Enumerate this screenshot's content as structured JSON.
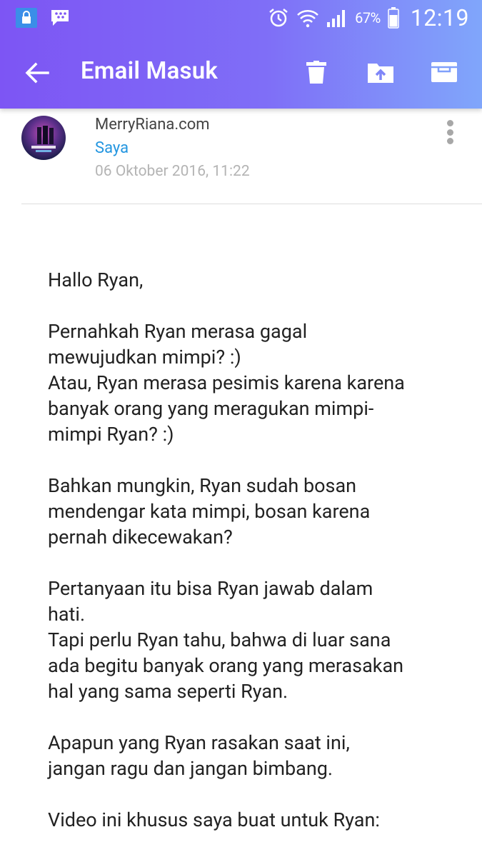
{
  "status_bar": {
    "battery_percent": "67%",
    "time": "12:19",
    "icons": [
      "lock-icon",
      "bbm-icon",
      "alarm-icon",
      "wifi-icon",
      "signal-icon",
      "battery-icon"
    ]
  },
  "app_bar": {
    "title": "Email Masuk",
    "back_icon": "arrow-back-icon",
    "actions": [
      "delete-icon",
      "move-to-folder-icon",
      "archive-icon"
    ],
    "gradient_colors": [
      "#7d55f4",
      "#80a6fb"
    ]
  },
  "message": {
    "sender": "MerryRiana.com",
    "recipient": "Saya",
    "date": "06 Oktober 2016, 11:22",
    "paragraphs": [
      "Hallo Ryan,",
      "Pernahkah Ryan merasa gagal\nmewujudkan mimpi? :)\nAtau, Ryan merasa pesimis karena karena\nbanyak orang yang meragukan mimpi-\nmimpi Ryan? :)",
      "Bahkan mungkin, Ryan sudah bosan\nmendengar kata mimpi, bosan karena\npernah dikecewakan?",
      "Pertanyaan itu bisa Ryan jawab dalam\nhati.\nTapi perlu Ryan tahu, bahwa di luar sana\nada begitu banyak orang yang merasakan\nhal yang sama seperti Ryan.",
      "Apapun yang Ryan rasakan saat ini,\njangan ragu dan jangan bimbang.",
      "Video ini khusus saya buat untuk Ryan:"
    ]
  },
  "colors": {
    "link": "#2496e0",
    "date_text": "#b4b4b4"
  }
}
